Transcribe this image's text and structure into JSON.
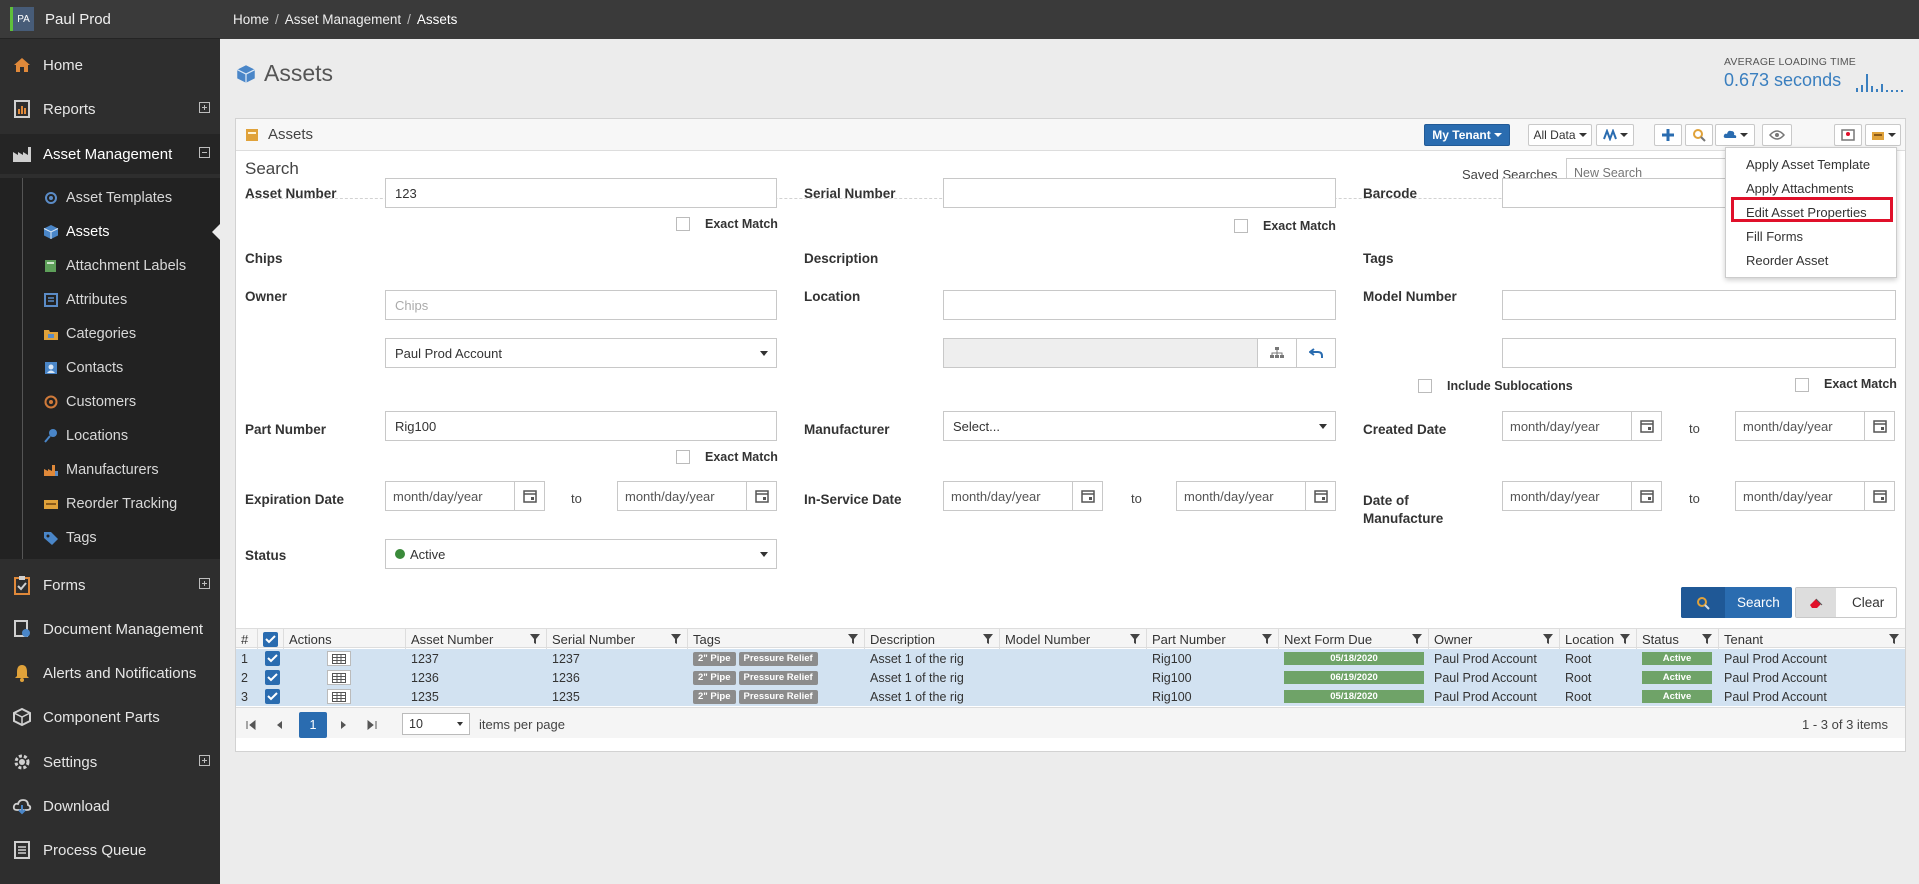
{
  "brand": {
    "initials": "PA",
    "name": "Paul Prod"
  },
  "breadcrumb": {
    "home": "Home",
    "section": "Asset Management",
    "current": "Assets"
  },
  "sidebar": {
    "items": [
      {
        "label": "Home"
      },
      {
        "label": "Reports"
      },
      {
        "label": "Asset Management"
      },
      {
        "label": "Forms"
      },
      {
        "label": "Document Management"
      },
      {
        "label": "Alerts and Notifications"
      },
      {
        "label": "Component Parts"
      },
      {
        "label": "Settings"
      },
      {
        "label": "Download"
      },
      {
        "label": "Process Queue"
      }
    ],
    "subitems": [
      {
        "label": "Asset Templates"
      },
      {
        "label": "Assets"
      },
      {
        "label": "Attachment Labels"
      },
      {
        "label": "Attributes"
      },
      {
        "label": "Categories"
      },
      {
        "label": "Contacts"
      },
      {
        "label": "Customers"
      },
      {
        "label": "Locations"
      },
      {
        "label": "Manufacturers"
      },
      {
        "label": "Reorder Tracking"
      },
      {
        "label": "Tags"
      }
    ]
  },
  "page": {
    "title": "Assets",
    "loading_label": "AVERAGE LOADING TIME",
    "loading_value": "0.673 seconds"
  },
  "panel": {
    "title": "Assets",
    "tenant_button": "My Tenant",
    "data_filter": "All Data"
  },
  "search": {
    "title": "Search",
    "saved_label": "Saved Searches",
    "saved_placeholder": "New Search",
    "exact_match": "Exact Match",
    "include_sublocations": "Include Sublocations",
    "to": "to",
    "date_placeholder": "month/day/year",
    "fields": {
      "asset_number": {
        "label": "Asset Number",
        "value": "123"
      },
      "serial_number": {
        "label": "Serial Number",
        "value": ""
      },
      "barcode": {
        "label": "Barcode",
        "value": ""
      },
      "chips": {
        "label": "Chips",
        "placeholder": "Chips"
      },
      "description": {
        "label": "Description",
        "value": ""
      },
      "tags": {
        "label": "Tags",
        "value": ""
      },
      "owner": {
        "label": "Owner",
        "value": "Paul Prod Account"
      },
      "location": {
        "label": "Location",
        "value": ""
      },
      "model_number": {
        "label": "Model Number",
        "value": ""
      },
      "part_number": {
        "label": "Part Number",
        "value": "Rig100"
      },
      "manufacturer": {
        "label": "Manufacturer",
        "value": "Select..."
      },
      "created_date": {
        "label": "Created Date"
      },
      "expiration_date": {
        "label": "Expiration Date"
      },
      "in_service_date": {
        "label": "In-Service Date"
      },
      "date_of_manufacture": {
        "label_line1": "Date of",
        "label_line2": "Manufacture"
      },
      "status": {
        "label": "Status",
        "value": "Active"
      }
    },
    "search_button": "Search",
    "clear_button": "Clear"
  },
  "grid": {
    "columns": [
      "#",
      "Actions",
      "Asset Number",
      "Serial Number",
      "Tags",
      "Description",
      "Model Number",
      "Part Number",
      "Next Form Due",
      "Owner",
      "Location",
      "Status",
      "Tenant"
    ],
    "rows": [
      {
        "num": "1",
        "asset_number": "1237",
        "serial_number": "1237",
        "tags": [
          "2\" Pipe",
          "Pressure Relief"
        ],
        "description": "Asset 1 of the rig",
        "model_number": "",
        "part_number": "Rig100",
        "next_form_due": "05/18/2020",
        "owner": "Paul Prod Account",
        "location": "Root",
        "status": "Active",
        "tenant": "Paul Prod Account"
      },
      {
        "num": "2",
        "asset_number": "1236",
        "serial_number": "1236",
        "tags": [
          "2\" Pipe",
          "Pressure Relief"
        ],
        "description": "Asset 1 of the rig",
        "model_number": "",
        "part_number": "Rig100",
        "next_form_due": "06/19/2020",
        "owner": "Paul Prod Account",
        "location": "Root",
        "status": "Active",
        "tenant": "Paul Prod Account"
      },
      {
        "num": "3",
        "asset_number": "1235",
        "serial_number": "1235",
        "tags": [
          "2\" Pipe",
          "Pressure Relief"
        ],
        "description": "Asset 1 of the rig",
        "model_number": "",
        "part_number": "Rig100",
        "next_form_due": "05/18/2020",
        "owner": "Paul Prod Account",
        "location": "Root",
        "status": "Active",
        "tenant": "Paul Prod Account"
      }
    ],
    "pager": {
      "current_page": "1",
      "per_page": "10",
      "per_page_label": "items per page",
      "info": "1 - 3 of 3 items"
    }
  },
  "menu": {
    "items": [
      "Apply Asset Template",
      "Apply Attachments",
      "Edit Asset Properties",
      "Fill Forms",
      "Reorder Asset"
    ],
    "highlighted": "Edit Asset Properties"
  },
  "colors": {
    "accent": "#2a6cb0",
    "sidebar": "#2e2e2e",
    "status_green": "#6fa368",
    "highlight_red": "#e0102a"
  }
}
